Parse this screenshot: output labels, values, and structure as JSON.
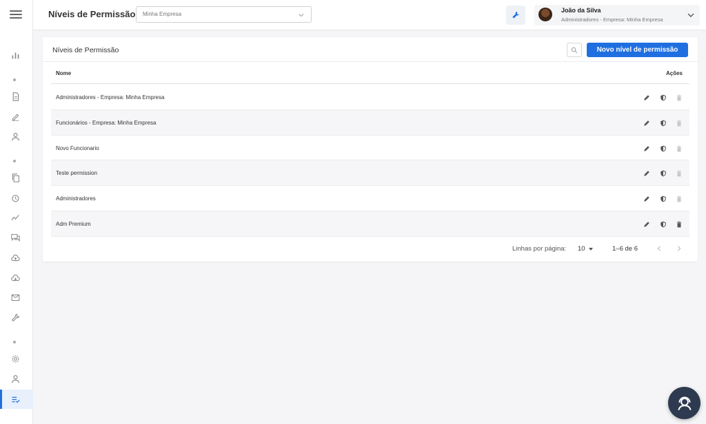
{
  "header": {
    "title": "Níveis de Permissão",
    "company_select": {
      "value": "Minha Empresa"
    }
  },
  "user": {
    "name": "João da Silva",
    "role": "Administradores - Empresa: Minha Empresa"
  },
  "card": {
    "title": "Níveis de Permissão",
    "new_button": "Novo nível de permissão"
  },
  "table": {
    "columns": [
      "Nome",
      "Ações"
    ],
    "rows": [
      {
        "name": "Administradores - Empresa: Minha Empresa",
        "delete_enabled": false
      },
      {
        "name": "Funcionários - Empresa: Minha Empresa",
        "delete_enabled": false
      },
      {
        "name": "Novo Funcionario",
        "delete_enabled": false
      },
      {
        "name": "Teste permission",
        "delete_enabled": false
      },
      {
        "name": "Administradores",
        "delete_enabled": false
      },
      {
        "name": "Adm Premium",
        "delete_enabled": true
      }
    ]
  },
  "pagination": {
    "rows_per_page_label": "Linhas por página:",
    "rows_per_page": "10",
    "range": "1–6 de 6"
  },
  "colors": {
    "primary": "#1f6fe0",
    "chat_fab": "#2d3a4f"
  }
}
